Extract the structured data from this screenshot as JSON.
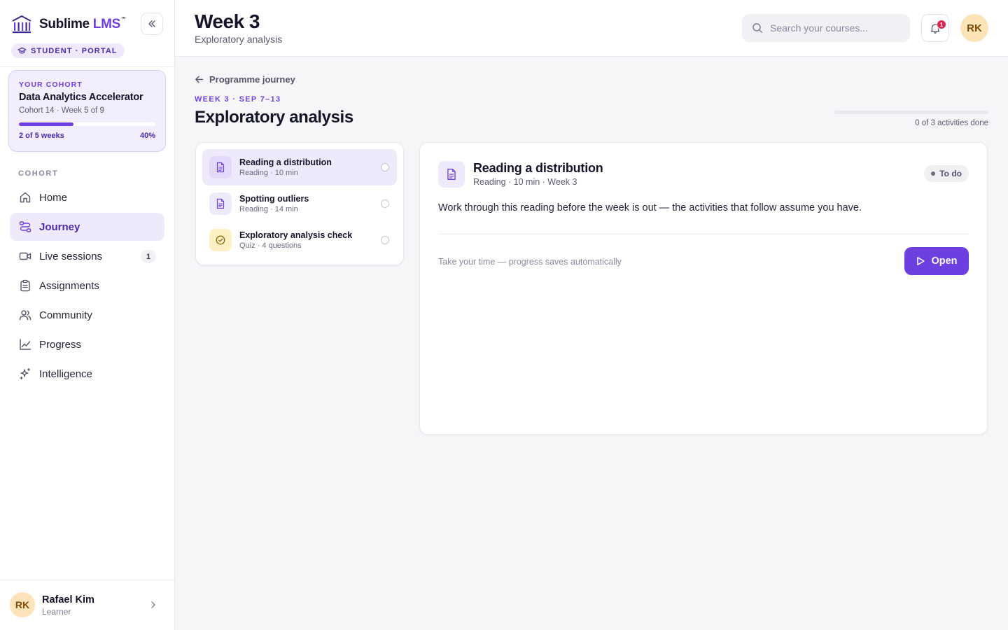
{
  "brand": {
    "name": "Sublime",
    "suffix": "LMS",
    "tm": "™",
    "accent": "#6d3fe0"
  },
  "portal_pill": "STUDENT · PORTAL",
  "cohort_card": {
    "eyebrow": "YOUR COHORT",
    "name": "Data Analytics Accelerator",
    "meta": "Cohort 14 · Week 5 of 9",
    "progress_fraction": 0.4,
    "weeks_text": "2 of 5 weeks",
    "percent_text": "40%"
  },
  "nav": {
    "heading": "COHORT",
    "items": [
      {
        "label": "Home",
        "icon": "home-icon"
      },
      {
        "label": "Journey",
        "icon": "route-icon",
        "active": true
      },
      {
        "label": "Live sessions",
        "icon": "video-icon",
        "badge": "1"
      },
      {
        "label": "Assignments",
        "icon": "clipboard-icon"
      },
      {
        "label": "Community",
        "icon": "users-icon"
      },
      {
        "label": "Progress",
        "icon": "chart-line-icon"
      },
      {
        "label": "Intelligence",
        "icon": "sparkles-icon"
      }
    ]
  },
  "user": {
    "initials": "RK",
    "name": "Rafael Kim",
    "role": "Learner"
  },
  "header": {
    "title": "Week 3",
    "subtitle": "Exploratory analysis",
    "search_placeholder": "Search your courses...",
    "notifications_count": "1",
    "avatar_initials": "RK"
  },
  "main": {
    "back_label": "Programme journey",
    "eyebrow": "WEEK 3 · SEP 7–13",
    "title": "Exploratory analysis",
    "progress_fraction": 0,
    "progress_text": "0 of 3 activities done",
    "activities": [
      {
        "title": "Reading a distribution",
        "meta": "Reading · 10 min",
        "icon": "document-icon",
        "selected": true
      },
      {
        "title": "Spotting outliers",
        "meta": "Reading · 14 min",
        "icon": "document-icon"
      },
      {
        "title": "Exploratory analysis check",
        "meta": "Quiz · 4 questions",
        "icon": "check-circle-icon"
      }
    ],
    "detail": {
      "title": "Reading a distribution",
      "meta": "Reading · 10 min · Week 3",
      "status": "To do",
      "body": "Work through this reading before the week is out — the activities that follow assume you have.",
      "hint": "Take your time — progress saves automatically",
      "open_label": "Open"
    }
  }
}
